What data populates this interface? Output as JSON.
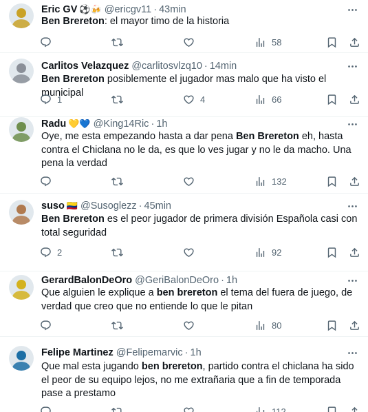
{
  "tweets": [
    {
      "name": "Eric GV",
      "emoji": "⚽🍻",
      "handle": "@ericgv11",
      "time": "43min",
      "text_parts": [
        {
          "t": "Ben Brereton",
          "bold": true
        },
        {
          "t": ": el mayor timo de la historia",
          "bold": false
        }
      ],
      "replies": "",
      "retweets": "",
      "likes": "",
      "views": "58",
      "avatar_color": "#c9a227"
    },
    {
      "name": "Carlitos Velazquez",
      "emoji": "",
      "handle": "@carlitosvlzq10",
      "time": "14min",
      "text_parts": [
        {
          "t": "Ben Brereton",
          "bold": true
        },
        {
          "t": " posiblemente el jugador mas malo que ha visto el municipal",
          "bold": false
        }
      ],
      "replies": "1",
      "retweets": "",
      "likes": "4",
      "views": "66",
      "avatar_color": "#8a8f98"
    },
    {
      "name": "Radu",
      "emoji": "💛💙",
      "handle": "@King14Ric",
      "time": "1h",
      "text_parts": [
        {
          "t": "Oye, me esta empezando hasta a dar pena ",
          "bold": false
        },
        {
          "t": "Ben Brereton",
          "bold": true
        },
        {
          "t": " eh, hasta contra el Chiclana no le da, es que lo ves jugar y no le da macho. Una pena la verdad",
          "bold": false
        }
      ],
      "replies": "",
      "retweets": "",
      "likes": "",
      "views": "132",
      "avatar_color": "#6f8f4e"
    },
    {
      "name": "suso",
      "emoji": "🇨🇴",
      "handle": "@Susoglezz",
      "time": "45min",
      "text_parts": [
        {
          "t": "Ben Brereton",
          "bold": true
        },
        {
          "t": " es el peor jugador de primera división Española casi con total seguridad",
          "bold": false
        }
      ],
      "replies": "2",
      "retweets": "",
      "likes": "",
      "views": "92",
      "avatar_color": "#b07a4f"
    },
    {
      "name": "GerardBalonDeOro",
      "emoji": "",
      "handle": "@GeriBalonDeOro",
      "time": "1h",
      "text_parts": [
        {
          "t": "Que alguien le explique a ",
          "bold": false
        },
        {
          "t": "ben brereton",
          "bold": true
        },
        {
          "t": " el tema del fuera de juego, de verdad que creo que no entiende lo que le pitan",
          "bold": false
        }
      ],
      "replies": "",
      "retweets": "",
      "likes": "",
      "views": "80",
      "avatar_color": "#d4b21e"
    },
    {
      "name": "Felipe Martinez",
      "emoji": "",
      "handle": "@Felipemarvic",
      "time": "1h",
      "text_parts": [
        {
          "t": "Que mal esta jugando ",
          "bold": false
        },
        {
          "t": "ben brereton",
          "bold": true
        },
        {
          "t": ", partido contra el chiclana ha sido el peor de su equipo lejos, no me extrañaria que a fin de temporada pase a prestamo",
          "bold": false
        }
      ],
      "replies": "",
      "retweets": "",
      "likes": "",
      "views": "112",
      "avatar_color": "#1d6fa5"
    }
  ]
}
